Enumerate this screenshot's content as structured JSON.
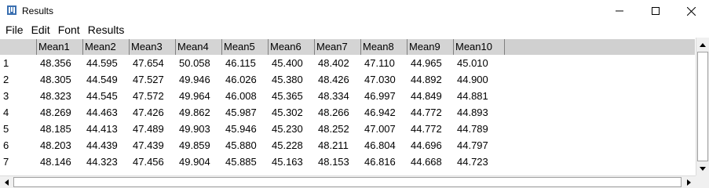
{
  "window": {
    "title": "Results"
  },
  "menu": [
    "File",
    "Edit",
    "Font",
    "Results"
  ],
  "table": {
    "columns": [
      "",
      "Mean1",
      "Mean2",
      "Mean3",
      "Mean4",
      "Mean5",
      "Mean6",
      "Mean7",
      "Mean8",
      "Mean9",
      "Mean10"
    ],
    "rows": [
      [
        "1",
        "48.356",
        "44.595",
        "47.654",
        "50.058",
        "46.115",
        "45.400",
        "48.402",
        "47.110",
        "44.965",
        "45.010"
      ],
      [
        "2",
        "48.305",
        "44.549",
        "47.527",
        "49.946",
        "46.026",
        "45.380",
        "48.426",
        "47.030",
        "44.892",
        "44.900"
      ],
      [
        "3",
        "48.323",
        "44.545",
        "47.572",
        "49.964",
        "46.008",
        "45.365",
        "48.334",
        "46.997",
        "44.849",
        "44.881"
      ],
      [
        "4",
        "48.269",
        "44.463",
        "47.426",
        "49.862",
        "45.987",
        "45.302",
        "48.266",
        "46.942",
        "44.772",
        "44.893"
      ],
      [
        "5",
        "48.185",
        "44.413",
        "47.489",
        "49.903",
        "45.946",
        "45.230",
        "48.252",
        "47.007",
        "44.772",
        "44.789"
      ],
      [
        "6",
        "48.203",
        "44.439",
        "47.439",
        "49.859",
        "45.880",
        "45.228",
        "48.211",
        "46.804",
        "44.696",
        "44.797"
      ],
      [
        "7",
        "48.146",
        "44.323",
        "47.456",
        "49.904",
        "45.885",
        "45.163",
        "48.153",
        "46.816",
        "44.668",
        "44.723"
      ]
    ]
  }
}
